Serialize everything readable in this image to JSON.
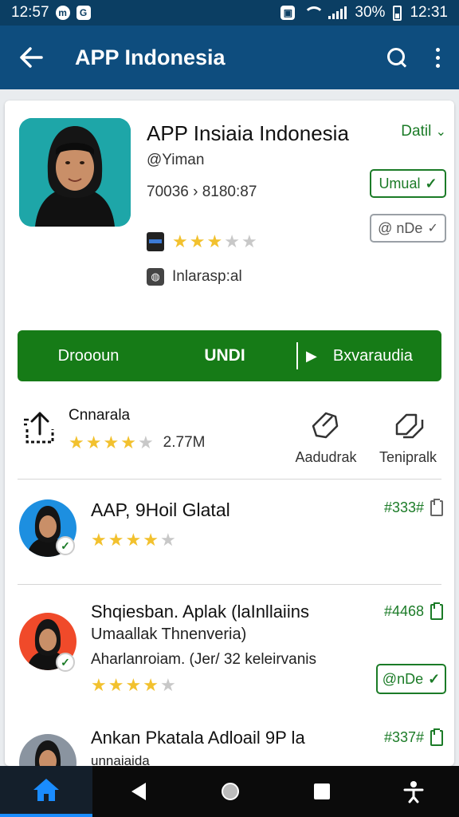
{
  "status_bar": {
    "time_left": "12:57",
    "battery": "30%",
    "time_right": "12:31",
    "badge_a": "m",
    "badge_b": "G"
  },
  "app_bar": {
    "title": "APP Indonesia"
  },
  "hero": {
    "title": "APP Insiaia Indonesia",
    "detail_link": "Datil",
    "handle": "@Yiman",
    "stats": "70036 › 8180:87",
    "pill_primary": "Umual",
    "pill_secondary": "@ nDe",
    "rating": {
      "value": 3,
      "max": 5
    },
    "category": "Inlarasp:al"
  },
  "action_bar": {
    "left": "Droooun",
    "middle": "UNDI",
    "right": "Bxvaraudia"
  },
  "featured": {
    "title": "Cnnarala",
    "rating": {
      "value": 4,
      "max": 5
    },
    "count": "2.77M",
    "action1": "Aadudrak",
    "action2": "Tenipralk"
  },
  "list": [
    {
      "title": "AAP, 9Hoil Glatal",
      "subtitle1": "",
      "subtitle2": "",
      "price": "#333#",
      "rating": {
        "value": 4,
        "max": 5
      },
      "avatar_bg": "#1d8fe0",
      "button": ""
    },
    {
      "title": "Shqiesban. Aplak (laInllaiins",
      "subtitle1": "Umaallak Thnenveria)",
      "subtitle2": "Aharlanroiam. (Jer/ 32 keleirvanis",
      "price": "#4468",
      "rating": {
        "value": 4,
        "max": 5
      },
      "avatar_bg": "#f04a2a",
      "button": "@nDe"
    },
    {
      "title": "Ankan Pkatala Adloail 9P la",
      "subtitle1": "unnaiaida",
      "subtitle2": "",
      "price": "#337#",
      "rating": null,
      "avatar_bg": "#8a94a0",
      "button": ""
    }
  ],
  "colors": {
    "app_bar": "#0e4d7e",
    "accent_green": "#167b17",
    "star": "#f2c12e"
  }
}
